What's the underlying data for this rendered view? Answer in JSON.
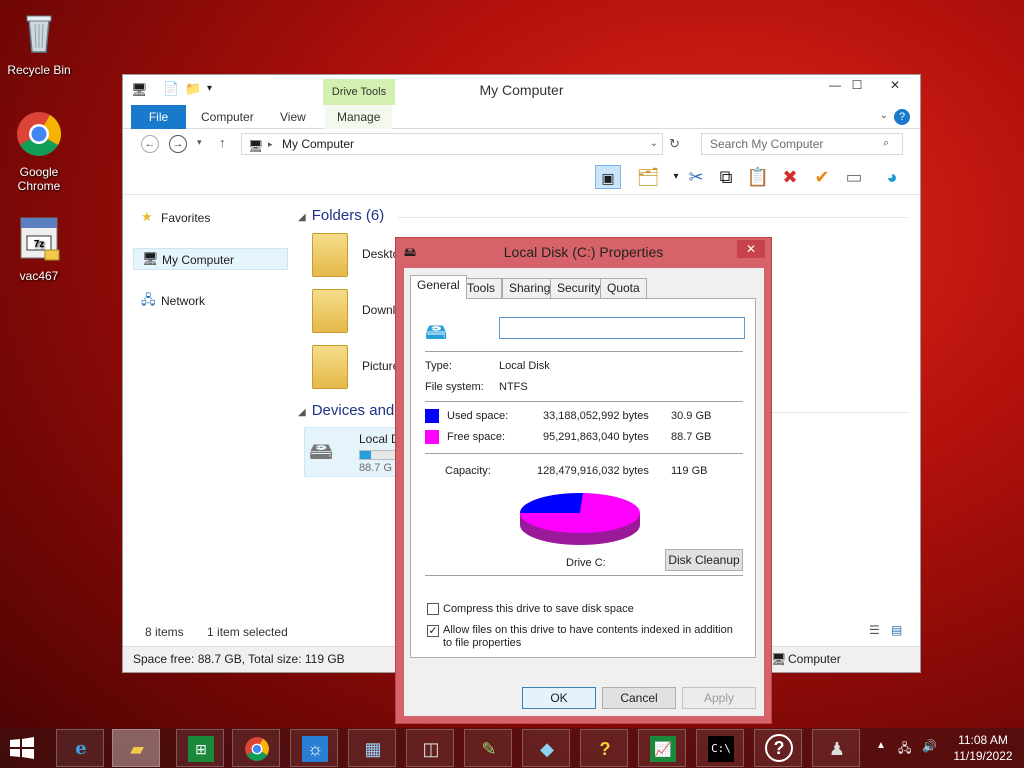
{
  "desktop": {
    "icons": [
      {
        "label": "Recycle Bin"
      },
      {
        "label": "Google Chrome"
      },
      {
        "label": "vac467"
      }
    ]
  },
  "explorer": {
    "title": "My Computer",
    "context_tab": "Drive Tools",
    "tabs": [
      {
        "label": "File"
      },
      {
        "label": "Computer"
      },
      {
        "label": "View"
      },
      {
        "label": "Manage"
      }
    ],
    "address": "My Computer",
    "search_placeholder": "Search My Computer",
    "nav": [
      {
        "label": "Favorites"
      },
      {
        "label": "My Computer"
      },
      {
        "label": "Network"
      }
    ],
    "folders_header": "Folders (6)",
    "folders": [
      {
        "label": "Desktop"
      },
      {
        "label": "Downloads"
      },
      {
        "label": "Pictures"
      }
    ],
    "devices_header": "Devices and",
    "drive": {
      "label": "Local D",
      "free": "88.7 G",
      "used_fraction": 0.26
    },
    "status_items": "8 items",
    "status_selected": "1 item selected",
    "status_space": "Space free: 88.7 GB, Total size: 119 GB",
    "status_computer": "Computer"
  },
  "dialog": {
    "title": "Local Disk (C:) Properties",
    "tabs": [
      {
        "label": "General"
      },
      {
        "label": "Tools"
      },
      {
        "label": "Sharing"
      },
      {
        "label": "Security"
      },
      {
        "label": "Quota"
      }
    ],
    "label_value": "",
    "type_label": "Type:",
    "type_value": "Local Disk",
    "fs_label": "File system:",
    "fs_value": "NTFS",
    "used_label": "Used space:",
    "used_bytes": "33,188,052,992 bytes",
    "used_gb": "30.9 GB",
    "free_label": "Free space:",
    "free_bytes": "95,291,863,040 bytes",
    "free_gb": "88.7 GB",
    "capacity_label": "Capacity:",
    "capacity_bytes": "128,479,916,032 bytes",
    "capacity_gb": "119 GB",
    "used_color": "#0000ff",
    "free_color": "#ff00ff",
    "used_fraction": 0.258,
    "drive_label": "Drive C:",
    "cleanup": "Disk Cleanup",
    "compress": "Compress this drive to save disk space",
    "compress_checked": false,
    "index": "Allow files on this drive to have contents indexed in addition to file properties",
    "index_checked": true,
    "ok": "OK",
    "cancel": "Cancel",
    "apply": "Apply"
  },
  "taskbar": {
    "time": "11:08 AM",
    "date": "11/19/2022"
  }
}
